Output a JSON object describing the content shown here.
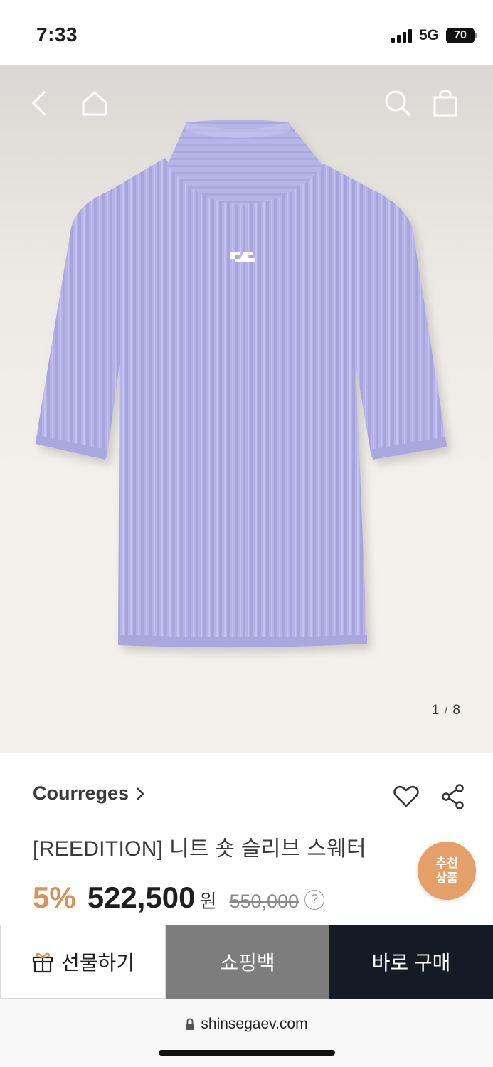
{
  "status_bar": {
    "time": "7:33",
    "network": "5G",
    "battery": "70"
  },
  "hero": {
    "image": "sweater-photo",
    "image_label": "Lavender ribbed knit short-sleeve turtleneck sweater",
    "pager": {
      "current": "1",
      "total": "8"
    },
    "nav_icons": {
      "back": "chevron-left-icon",
      "home": "home-icon",
      "search": "search-icon",
      "bag": "shopping-bag-icon"
    }
  },
  "product": {
    "brand": "Courreges",
    "title": "[REEDITION] 니트 숏 슬리브 스웨터",
    "discount": "5%",
    "price": "522,500",
    "currency": "원",
    "original_price": "550,000",
    "help": "?",
    "recommend_badge": [
      "추천",
      "상품"
    ]
  },
  "actions": {
    "gift": "선물하기",
    "cart": "쇼핑백",
    "buy_now": "바로 구매"
  },
  "browser": {
    "url": "shinsegaev.com"
  },
  "colors": {
    "accent": "#d9925a",
    "badge": "#e4a068",
    "buy_button": "#141b26",
    "cart_button": "#7d7d7d",
    "sweater": "#b4b2e6"
  }
}
